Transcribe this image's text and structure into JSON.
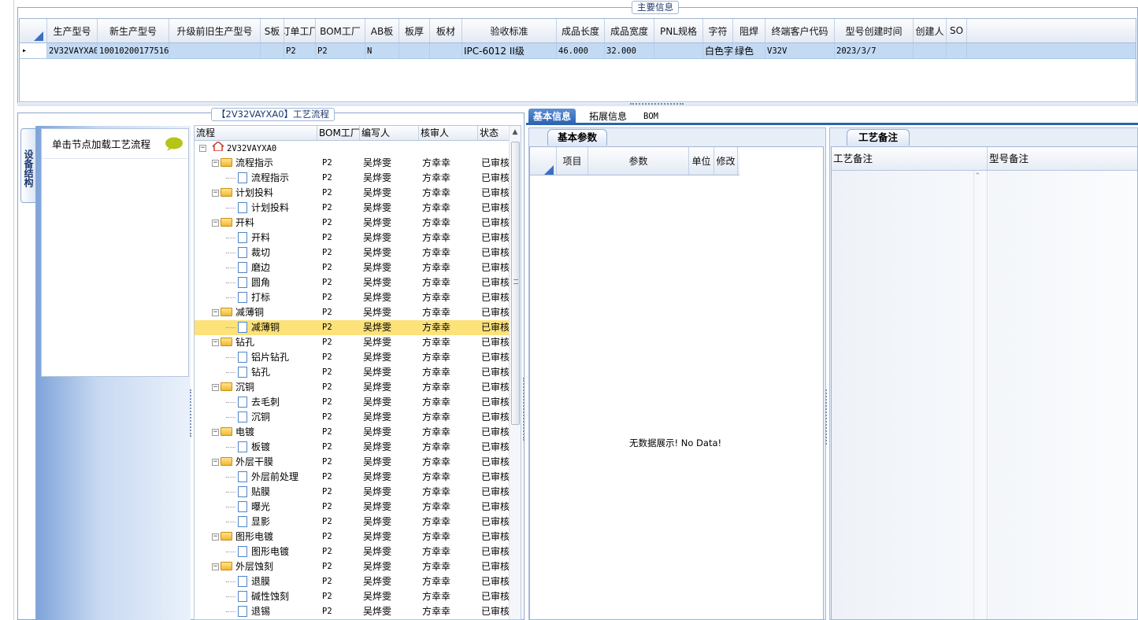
{
  "main_info": {
    "legend": "主要信息",
    "columns": [
      "生产型号",
      "新生产型号",
      "升级前旧生产型号",
      "S板",
      "订单工厂",
      "BOM工厂",
      "AB板",
      "板厚",
      "板材",
      "验收标准",
      "成品长度",
      "成品宽度",
      "PNL规格",
      "字符",
      "阻焊",
      "终端客户代码",
      "型号创建时间",
      "创建人",
      "SO"
    ],
    "row": [
      "2V32VAYXA0",
      "10010200177516",
      "",
      "",
      "P2",
      "P2",
      "N",
      "",
      "",
      "IPC-6012 II级",
      "46.000",
      "32.000",
      "",
      "白色字符",
      "绿色",
      "V32V",
      "2023/3/7",
      "",
      ""
    ]
  },
  "process": {
    "legend": "【2V32VAYXA0】工艺流程",
    "side_tab": "设备结构",
    "load_hint": "单击节点加载工艺流程",
    "columns": [
      "流程",
      "BOM工厂",
      "编写人",
      "核审人",
      "状态"
    ],
    "root": "2V32VAYXA0",
    "nodes": [
      {
        "name": "流程指示",
        "level": 1,
        "bom": "P2",
        "writer": "吴烨雯",
        "reviewer": "方幸幸",
        "status": "已审核"
      },
      {
        "name": "流程指示",
        "level": 2,
        "bom": "P2",
        "writer": "吴烨雯",
        "reviewer": "方幸幸",
        "status": "已审核"
      },
      {
        "name": "计划投料",
        "level": 1,
        "bom": "P2",
        "writer": "吴烨雯",
        "reviewer": "方幸幸",
        "status": "已审核"
      },
      {
        "name": "计划投料",
        "level": 2,
        "bom": "P2",
        "writer": "吴烨雯",
        "reviewer": "方幸幸",
        "status": "已审核"
      },
      {
        "name": "开料",
        "level": 1,
        "bom": "P2",
        "writer": "吴烨雯",
        "reviewer": "方幸幸",
        "status": "已审核"
      },
      {
        "name": "开料",
        "level": 2,
        "bom": "P2",
        "writer": "吴烨雯",
        "reviewer": "方幸幸",
        "status": "已审核"
      },
      {
        "name": "裁切",
        "level": 2,
        "bom": "P2",
        "writer": "吴烨雯",
        "reviewer": "方幸幸",
        "status": "已审核"
      },
      {
        "name": "磨边",
        "level": 2,
        "bom": "P2",
        "writer": "吴烨雯",
        "reviewer": "方幸幸",
        "status": "已审核"
      },
      {
        "name": "圆角",
        "level": 2,
        "bom": "P2",
        "writer": "吴烨雯",
        "reviewer": "方幸幸",
        "status": "已审核"
      },
      {
        "name": "打标",
        "level": 2,
        "bom": "P2",
        "writer": "吴烨雯",
        "reviewer": "方幸幸",
        "status": "已审核"
      },
      {
        "name": "减薄铜",
        "level": 1,
        "bom": "P2",
        "writer": "吴烨雯",
        "reviewer": "方幸幸",
        "status": "已审核"
      },
      {
        "name": "减薄铜",
        "level": 2,
        "bom": "P2",
        "writer": "吴烨雯",
        "reviewer": "方幸幸",
        "status": "已审核",
        "selected": true
      },
      {
        "name": "钻孔",
        "level": 1,
        "bom": "P2",
        "writer": "吴烨雯",
        "reviewer": "方幸幸",
        "status": "已审核"
      },
      {
        "name": "铝片钻孔",
        "level": 2,
        "bom": "P2",
        "writer": "吴烨雯",
        "reviewer": "方幸幸",
        "status": "已审核"
      },
      {
        "name": "钻孔",
        "level": 2,
        "bom": "P2",
        "writer": "吴烨雯",
        "reviewer": "方幸幸",
        "status": "已审核"
      },
      {
        "name": "沉铜",
        "level": 1,
        "bom": "P2",
        "writer": "吴烨雯",
        "reviewer": "方幸幸",
        "status": "已审核"
      },
      {
        "name": "去毛刺",
        "level": 2,
        "bom": "P2",
        "writer": "吴烨雯",
        "reviewer": "方幸幸",
        "status": "已审核"
      },
      {
        "name": "沉铜",
        "level": 2,
        "bom": "P2",
        "writer": "吴烨雯",
        "reviewer": "方幸幸",
        "status": "已审核"
      },
      {
        "name": "电镀",
        "level": 1,
        "bom": "P2",
        "writer": "吴烨雯",
        "reviewer": "方幸幸",
        "status": "已审核"
      },
      {
        "name": "板镀",
        "level": 2,
        "bom": "P2",
        "writer": "吴烨雯",
        "reviewer": "方幸幸",
        "status": "已审核"
      },
      {
        "name": "外层干膜",
        "level": 1,
        "bom": "P2",
        "writer": "吴烨雯",
        "reviewer": "方幸幸",
        "status": "已审核"
      },
      {
        "name": "外层前处理",
        "level": 2,
        "bom": "P2",
        "writer": "吴烨雯",
        "reviewer": "方幸幸",
        "status": "已审核"
      },
      {
        "name": "贴膜",
        "level": 2,
        "bom": "P2",
        "writer": "吴烨雯",
        "reviewer": "方幸幸",
        "status": "已审核"
      },
      {
        "name": "曝光",
        "level": 2,
        "bom": "P2",
        "writer": "吴烨雯",
        "reviewer": "方幸幸",
        "status": "已审核"
      },
      {
        "name": "显影",
        "level": 2,
        "bom": "P2",
        "writer": "吴烨雯",
        "reviewer": "方幸幸",
        "status": "已审核"
      },
      {
        "name": "图形电镀",
        "level": 1,
        "bom": "P2",
        "writer": "吴烨雯",
        "reviewer": "方幸幸",
        "status": "已审核"
      },
      {
        "name": "图形电镀",
        "level": 2,
        "bom": "P2",
        "writer": "吴烨雯",
        "reviewer": "方幸幸",
        "status": "已审核"
      },
      {
        "name": "外层蚀刻",
        "level": 1,
        "bom": "P2",
        "writer": "吴烨雯",
        "reviewer": "方幸幸",
        "status": "已审核"
      },
      {
        "name": "退膜",
        "level": 2,
        "bom": "P2",
        "writer": "吴烨雯",
        "reviewer": "方幸幸",
        "status": "已审核"
      },
      {
        "name": "碱性蚀刻",
        "level": 2,
        "bom": "P2",
        "writer": "吴烨雯",
        "reviewer": "方幸幸",
        "status": "已审核"
      },
      {
        "name": "退锡",
        "level": 2,
        "bom": "P2",
        "writer": "吴烨雯",
        "reviewer": "方幸幸",
        "status": "已审核"
      }
    ]
  },
  "detail": {
    "tabs": [
      "基本信息",
      "拓展信息",
      "BOM"
    ],
    "params_tab": "基本参数",
    "params_columns": [
      "项目",
      "参数",
      "单位",
      "修改"
    ],
    "empty_text": "无数据展示! No Data!",
    "remark_tab": "工艺备注",
    "remark_columns": [
      "工艺备注",
      "型号备注"
    ]
  },
  "colors": {
    "accent": "#2a63b2",
    "selected_row": "#fde27a",
    "grid_selected": "#c3daf3"
  }
}
